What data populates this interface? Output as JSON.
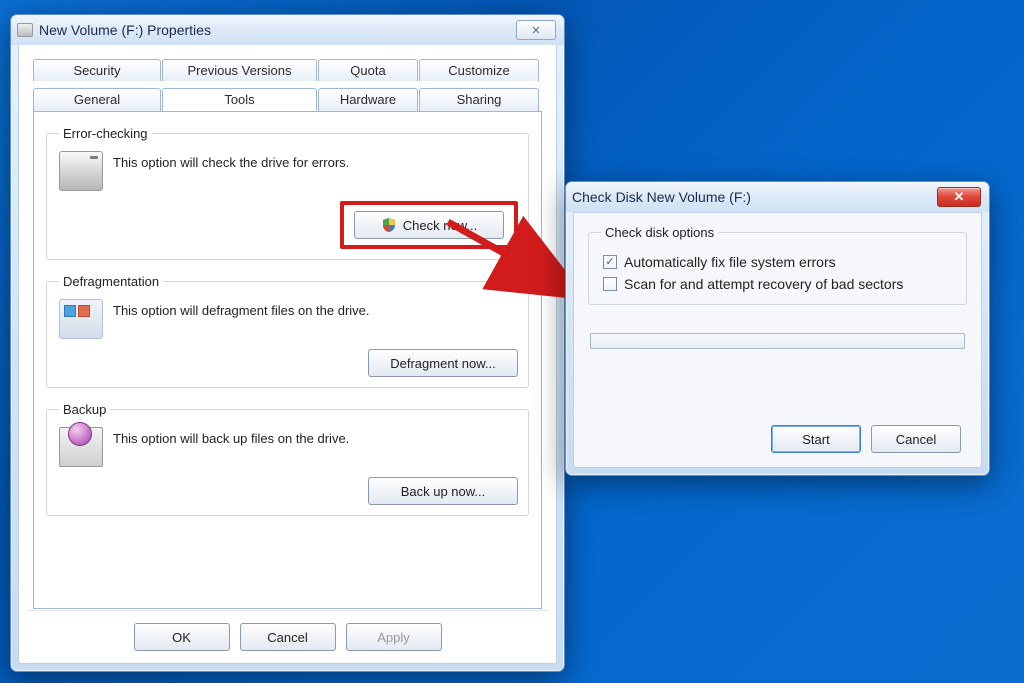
{
  "properties": {
    "title": "New Volume (F:) Properties",
    "tabs_row1": [
      "Security",
      "Previous Versions",
      "Quota",
      "Customize"
    ],
    "tabs_row2": [
      "General",
      "Tools",
      "Hardware",
      "Sharing"
    ],
    "active_tab": "Tools",
    "groups": {
      "error_checking": {
        "legend": "Error-checking",
        "desc": "This option will check the drive for errors.",
        "button": "Check now..."
      },
      "defragmentation": {
        "legend": "Defragmentation",
        "desc": "This option will defragment files on the drive.",
        "button": "Defragment now..."
      },
      "backup": {
        "legend": "Backup",
        "desc": "This option will back up files on the drive.",
        "button": "Back up now..."
      }
    },
    "buttons": {
      "ok": "OK",
      "cancel": "Cancel",
      "apply": "Apply"
    }
  },
  "chkdsk": {
    "title": "Check Disk New Volume (F:)",
    "group_legend": "Check disk options",
    "option_auto_fix": {
      "label": "Automatically fix file system errors",
      "checked": true
    },
    "option_scan_bad": {
      "label": "Scan for and attempt recovery of bad sectors",
      "checked": false
    },
    "buttons": {
      "start": "Start",
      "cancel": "Cancel"
    }
  }
}
